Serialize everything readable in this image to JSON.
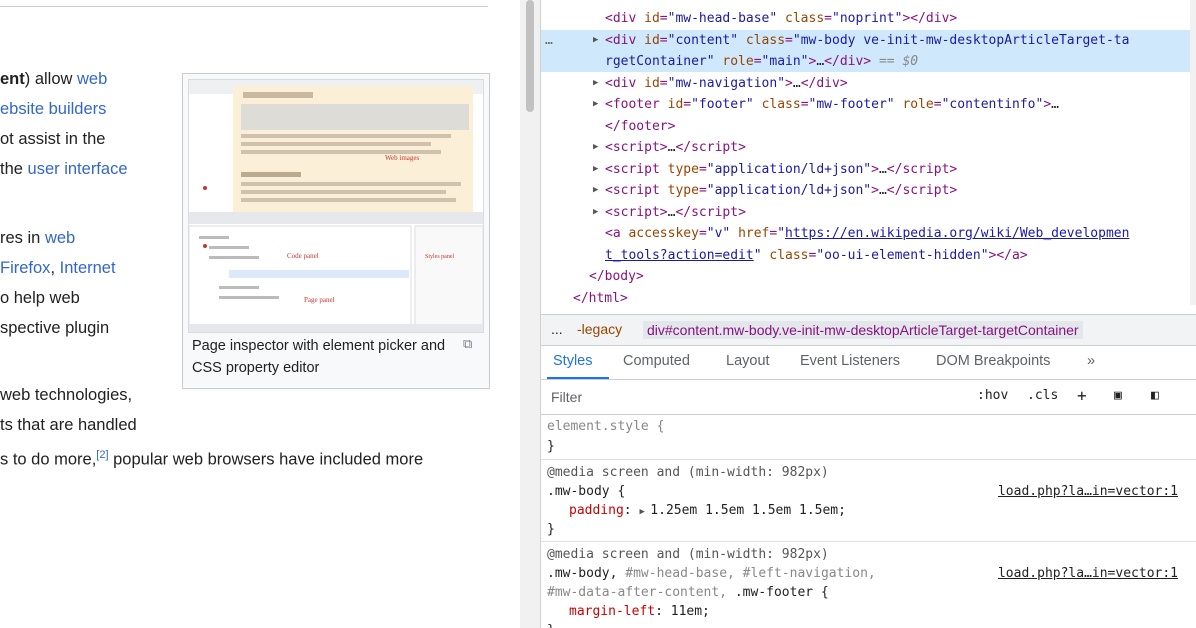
{
  "article": {
    "lines": [
      {
        "parts": [
          {
            "t": "ent",
            "b": true
          },
          {
            "t": ") allow "
          },
          {
            "t": "web",
            "a": true
          }
        ]
      },
      {
        "parts": [
          {
            "t": "ebsite builders",
            "a": true
          }
        ]
      },
      {
        "parts": [
          {
            "t": "ot assist in the"
          }
        ]
      },
      {
        "parts": [
          {
            "t": " the "
          },
          {
            "t": "user interface",
            "a": true
          }
        ]
      },
      {
        "parts": [
          {
            "t": "res in "
          },
          {
            "t": "web",
            "a": true
          }
        ]
      },
      {
        "parts": [
          {
            "t": "Firefox",
            "a": true
          },
          {
            "t": ", "
          },
          {
            "t": "Internet",
            "a": true
          }
        ]
      },
      {
        "parts": [
          {
            "t": "o help web"
          }
        ]
      },
      {
        "parts": [
          {
            "t": "spective plugin"
          }
        ]
      },
      {
        "parts": [
          {
            "t": " web technologies,"
          }
        ]
      },
      {
        "parts": [
          {
            "t": "ts that are handled"
          }
        ]
      },
      {
        "parts": [
          {
            "t": "s to do more,"
          },
          {
            "t": "[2]",
            "sup": true
          },
          {
            "t": " popular web browsers have included more"
          }
        ]
      }
    ],
    "thumb_caption": "Page inspector with element picker and CSS property editor",
    "thumb_labels": {
      "web_images": "Web images",
      "code_view": "Code panel",
      "css_panel": "Styles panel",
      "page_panel": "Page panel"
    }
  },
  "devtools": {
    "dom_lines": [
      {
        "indent": 3,
        "html": "<span class='t-tag'>&lt;div</span> <span class='t-attr'>id</span>=<span class='t-val'>\"mw-head-base\"</span> <span class='t-attr'>class</span>=<span class='t-val'>\"noprint\"</span><span class='t-tag'>&gt;&lt;/div&gt;</span>"
      },
      {
        "indent": 3,
        "tri": true,
        "selected": true,
        "dots": true,
        "html": "<span class='t-tag'>&lt;div</span> <span class='t-attr'>id</span>=<span class='t-val'>\"content\"</span> <span class='t-attr'>class</span>=<span class='t-val'>\"mw-body ve-init-mw-desktopArticleTarget-ta</span>"
      },
      {
        "indent": 3,
        "selected": true,
        "html": "<span class='t-val'>rgetContainer\"</span> <span class='t-attr'>role</span>=<span class='t-val'>\"main\"</span><span class='t-tag'>&gt;</span><span class='t-txt'>…</span><span class='t-tag'>&lt;/div&gt;</span> <span class='t-dim'>== $0</span>"
      },
      {
        "indent": 3,
        "tri": true,
        "html": "<span class='t-tag'>&lt;div</span> <span class='t-attr'>id</span>=<span class='t-val'>\"mw-navigation\"</span><span class='t-tag'>&gt;</span><span class='t-txt'>…</span><span class='t-tag'>&lt;/div&gt;</span>"
      },
      {
        "indent": 3,
        "tri": true,
        "html": "<span class='t-tag'>&lt;footer</span> <span class='t-attr'>id</span>=<span class='t-val'>\"footer\"</span> <span class='t-attr'>class</span>=<span class='t-val'>\"mw-footer\"</span> <span class='t-attr'>role</span>=<span class='t-val'>\"contentinfo\"</span><span class='t-tag'>&gt;</span><span class='t-txt'>…</span>"
      },
      {
        "indent": 3,
        "html": "<span class='t-tag'>&lt;/footer&gt;</span>"
      },
      {
        "indent": 3,
        "tri": true,
        "html": "<span class='t-tag'>&lt;script&gt;</span><span class='t-txt'>…</span><span class='t-tag'>&lt;/script&gt;</span>"
      },
      {
        "indent": 3,
        "tri": true,
        "html": "<span class='t-tag'>&lt;script</span> <span class='t-attr'>type</span>=<span class='t-val'>\"application/ld+json\"</span><span class='t-tag'>&gt;</span><span class='t-txt'>…</span><span class='t-tag'>&lt;/script&gt;</span>"
      },
      {
        "indent": 3,
        "tri": true,
        "html": "<span class='t-tag'>&lt;script</span> <span class='t-attr'>type</span>=<span class='t-val'>\"application/ld+json\"</span><span class='t-tag'>&gt;</span><span class='t-txt'>…</span><span class='t-tag'>&lt;/script&gt;</span>"
      },
      {
        "indent": 3,
        "tri": true,
        "html": "<span class='t-tag'>&lt;script&gt;</span><span class='t-txt'>…</span><span class='t-tag'>&lt;/script&gt;</span>"
      },
      {
        "indent": 3,
        "html": "<span class='t-tag'>&lt;a</span> <span class='t-attr'>accesskey</span>=<span class='t-val'>\"v\"</span> <span class='t-attr'>href</span>=<span class='t-val'>\"</span><span class='t-link'>https://en.wikipedia.org/wiki/Web_developmen</span>"
      },
      {
        "indent": 3,
        "html": "<span class='t-link'>t_tools?action=edit</span><span class='t-val'>\"</span> <span class='t-attr'>class</span>=<span class='t-val'>\"oo-ui-element-hidden\"</span><span class='t-tag'>&gt;&lt;/a&gt;</span>"
      },
      {
        "indent": 2,
        "html": "<span class='t-tag'>&lt;/body&gt;</span>"
      },
      {
        "indent": 1,
        "html": "<span class='t-tag'>&lt;/html&gt;</span>"
      }
    ],
    "crumbs": {
      "dots": "...",
      "first": "-legacy",
      "current": "div#content.mw-body.ve-init-mw-desktopArticleTarget-targetContainer"
    },
    "tabs": [
      "Styles",
      "Computed",
      "Layout",
      "Event Listeners",
      "DOM Breakpoints",
      "»"
    ],
    "filter": {
      "placeholder": "Filter",
      "hov": ":hov",
      "cls": ".cls",
      "plus": "+"
    },
    "rules": {
      "element_style": "element.style {",
      "close": "}",
      "r1_media": "@media screen and (min-width: 982px)",
      "r1_selector": ".mw-body {",
      "r1_source": "load.php?la…in=vector:1",
      "r1_prop": "padding",
      "r1_value": "1.25em 1.5em 1.5em 1.5em;",
      "r2_media": "@media screen and (min-width: 982px)",
      "r2_sel_a": ".mw-body, ",
      "r2_sel_b": "#mw-head-base, #left-navigation,",
      "r2_sel_c": "#mw-data-after-content, ",
      "r2_sel_d": ".mw-footer {",
      "r2_source": "load.php?la…in=vector:1",
      "r2_prop": "margin-left",
      "r2_value": "11em;"
    }
  },
  "colors": {
    "link": "#3366cc",
    "devtools_accent": "#1a73e8",
    "selected_row": "#cfe8fc"
  }
}
